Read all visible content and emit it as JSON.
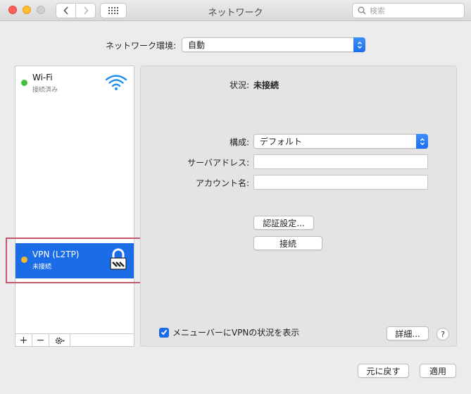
{
  "window": {
    "title": "ネットワーク",
    "search_placeholder": "検索"
  },
  "location": {
    "label": "ネットワーク環境:",
    "value": "自動"
  },
  "services": [
    {
      "name": "Wi-Fi",
      "status": "接続済み",
      "status_color": "#3ec13e",
      "icon": "wifi-icon",
      "selected": false
    },
    {
      "name": "VPN (L2TP)",
      "status": "未接続",
      "status_color": "#f7b731",
      "icon": "lock-icon",
      "selected": true
    }
  ],
  "sidebar_tools": {
    "add": "+",
    "remove": "−"
  },
  "detail": {
    "status_label": "状況:",
    "status_value": "未接続",
    "config_label": "構成:",
    "config_value": "デフォルト",
    "server_label": "サーバアドレス:",
    "server_value": "",
    "account_label": "アカウント名:",
    "account_value": "",
    "auth_button": "認証設定...",
    "connect_button": "接続",
    "show_vpn_label": "メニューバーにVPNの状況を表示",
    "show_vpn_checked": true,
    "advanced_button": "詳細...",
    "help_button": "?"
  },
  "footer": {
    "revert_button": "元に戻す",
    "apply_button": "適用"
  },
  "colors": {
    "selection": "#1a6de6",
    "highlight_box": "#c4586a"
  }
}
